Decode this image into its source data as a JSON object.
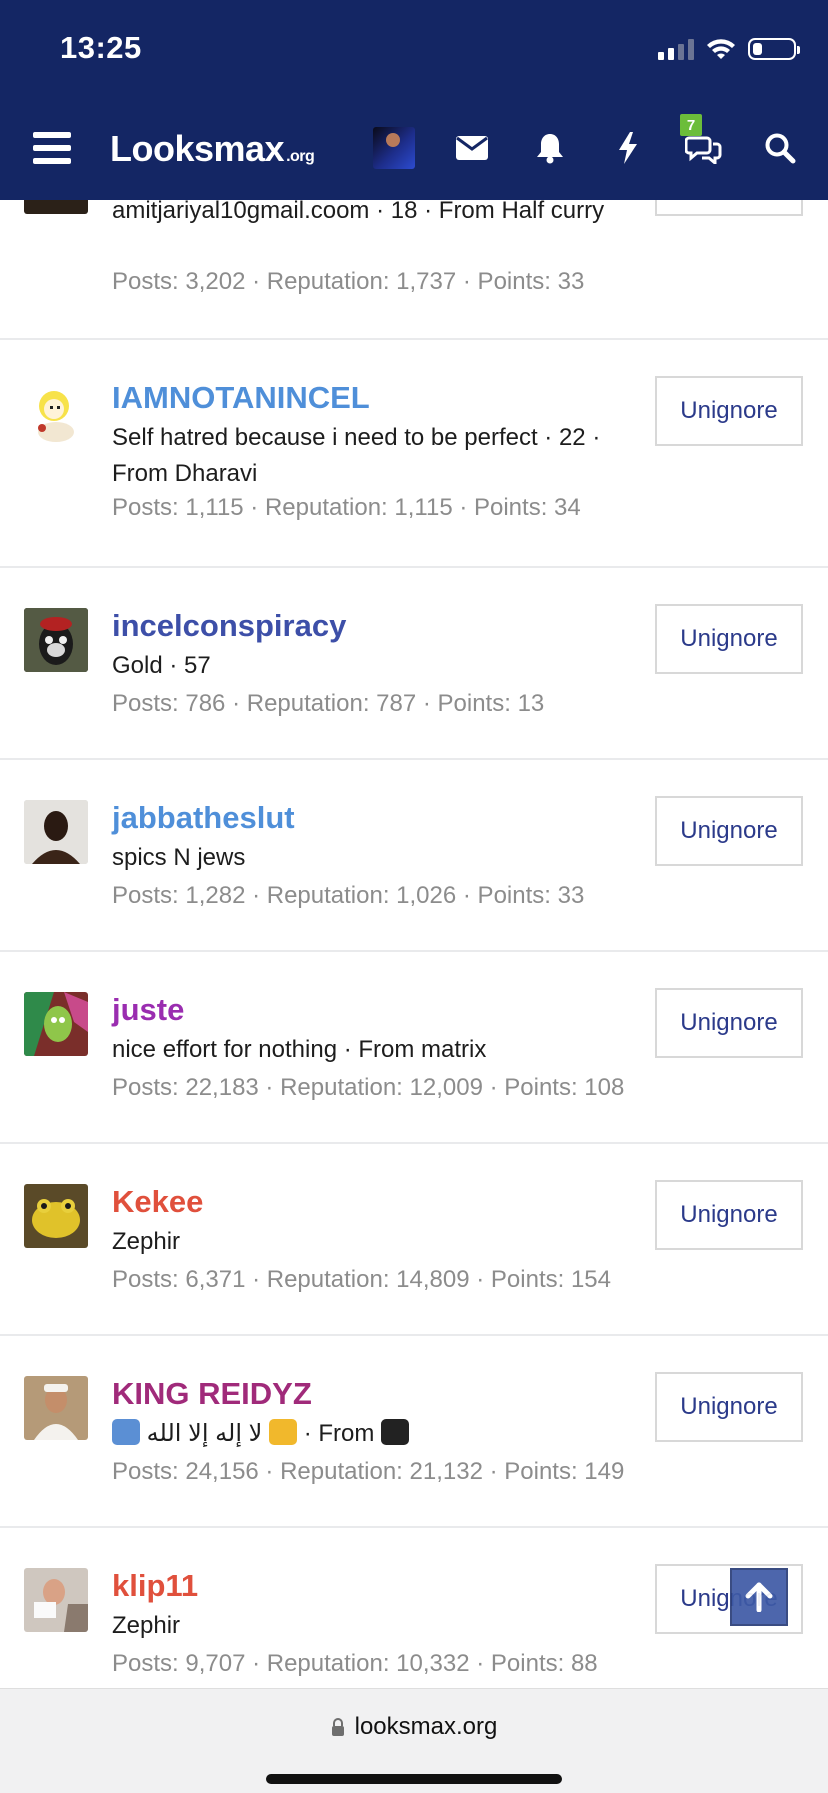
{
  "status_bar": {
    "time": "13:25"
  },
  "header": {
    "logo_main": "Looksmax",
    "logo_suffix": ".org",
    "conversations_badge": "7"
  },
  "members": [
    {
      "username": "",
      "title": "amitjariyal10gmail.coom · 18 · From Half curry",
      "stats": "Posts: 3,202 · Reputation: 1,737 · Points: 33",
      "button": ""
    },
    {
      "username": "IAMNOTANINCEL",
      "name_color": "#4f8fd9",
      "title": "Self hatred because i need to be perfect · 22 · From Dharavi",
      "stats": "Posts: 1,115 · Reputation: 1,115 · Points: 34",
      "button": "Unignore"
    },
    {
      "username": "incelconspiracy",
      "name_color": "#3d4fa8",
      "title": "Gold · 57",
      "stats": "Posts: 786 · Reputation: 787 · Points: 13",
      "button": "Unignore"
    },
    {
      "username": "jabbatheslut",
      "name_color": "#4f8fd9",
      "title": "spics N jews",
      "stats": "Posts: 1,282 · Reputation: 1,026 · Points: 33",
      "button": "Unignore"
    },
    {
      "username": "juste",
      "name_color": "#9a2db0",
      "title": "nice effort for nothing · From matrix",
      "stats": "Posts: 22,183 · Reputation: 12,009 · Points: 108",
      "button": "Unignore"
    },
    {
      "username": "Kekee",
      "name_color": "#e0503c",
      "title": "Zephir",
      "stats": "Posts: 6,371 · Reputation: 14,809 · Points: 154",
      "button": "Unignore"
    },
    {
      "username": "KING REIDYZ",
      "name_color": "#a02a7a",
      "title_text": "لا إله إلا الله",
      "title_from": "· From",
      "stats": "Posts: 24,156 · Reputation: 21,132 · Points: 149",
      "button": "Unignore"
    },
    {
      "username": "klip11",
      "name_color": "#e0503c",
      "title": "Zephir",
      "stats": "Posts: 9,707 · Reputation: 10,332 · Points: 88",
      "button": "Unignore"
    }
  ],
  "browser": {
    "url": "looksmax.org"
  },
  "icons": [
    "menu-icon",
    "mail-icon",
    "bell-icon",
    "lightning-icon",
    "conversations-icon",
    "search-icon",
    "lock-icon",
    "arrow-up-icon"
  ]
}
